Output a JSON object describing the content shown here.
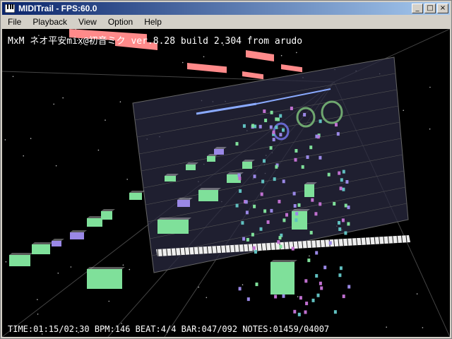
{
  "window": {
    "title": "MIDITrail - FPS:60.0",
    "icon": "piano-keys-icon",
    "controls": {
      "minimize": "_",
      "maximize": "□",
      "close": "×"
    }
  },
  "menu": {
    "items": [
      {
        "label": "File"
      },
      {
        "label": "Playback"
      },
      {
        "label": "View"
      },
      {
        "label": "Option"
      },
      {
        "label": "Help"
      }
    ]
  },
  "viewport": {
    "song_title": "MxM ネオ平安mix@初音ミク ver.8.28 build 2.304 from arudo",
    "status": "TIME:01:15/02:30 BPM:146 BEAT:4/4 BAR:047/092 NOTES:01459/04007"
  },
  "colors": {
    "green_note": "#7fe09a",
    "purple_note": "#9a88e6",
    "pink_note": "#ff8a8a",
    "magenta_note": "#c070d0",
    "cyan_note": "#60c0c0",
    "plane": "#2a2a40",
    "ring": "#6fa76f"
  }
}
